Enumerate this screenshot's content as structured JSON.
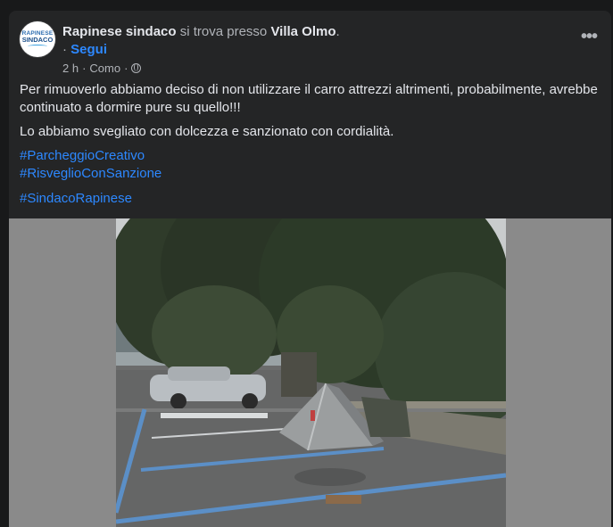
{
  "author": "Rapinese sindaco",
  "at_text": "si trova presso",
  "location": "Villa Olmo",
  "period": ".",
  "dot_sep": "·",
  "follow_label": "Segui",
  "time": "2 h",
  "place": "Como",
  "avatar": {
    "line1": "RAPINESE",
    "line2": "SINDACO"
  },
  "more_label": "•••",
  "body": {
    "p1": "Per rimuoverlo abbiamo deciso di non utilizzare il carro attrezzi altrimenti, probabilmente, avrebbe continuato a dormire pure su quello!!!",
    "p2": "Lo abbiamo svegliato con dolcezza e sanzionato con cordialità.",
    "hashtags": [
      "#ParcheggioCreativo",
      "#RisveglioConSanzione",
      "#SindacoRapinese"
    ]
  },
  "colors": {
    "link": "#2d88ff",
    "card": "#242526",
    "text": "#e4e6eb",
    "muted": "#b0b3b8"
  },
  "icons": [
    "globe-icon",
    "more-options-icon"
  ]
}
